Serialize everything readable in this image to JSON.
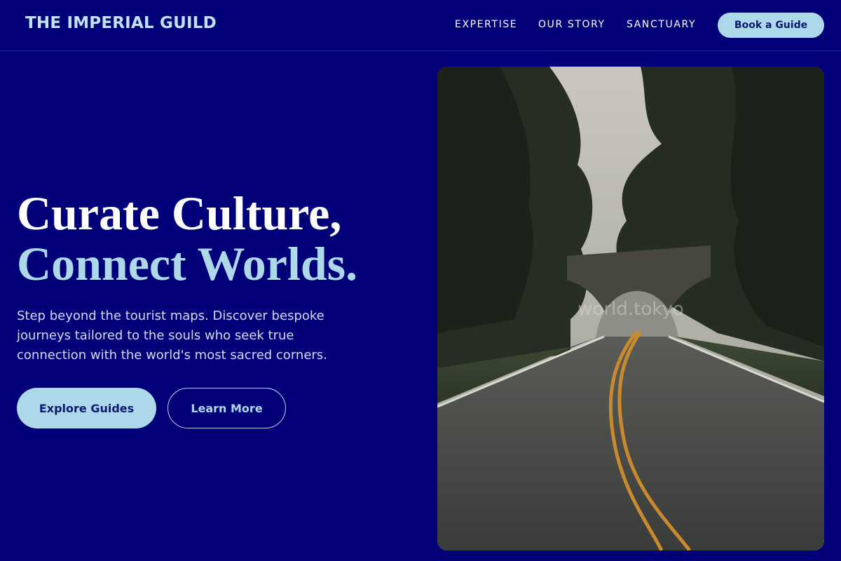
{
  "header": {
    "logo": "THE IMPERIAL GUILD",
    "nav": [
      "EXPERTISE",
      "OUR STORY",
      "SANCTUARY"
    ],
    "cta": "Book a Guide"
  },
  "hero": {
    "title_line1": "Curate Culture,",
    "title_line2": "Connect Worlds.",
    "description": "Step beyond the tourist maps. Discover bespoke journeys tailored to the souls who seek true connection with the world's most sacred corners.",
    "primary_button": "Explore Guides",
    "secondary_button": "Learn More",
    "image_watermark": "world.tokyo"
  },
  "colors": {
    "background": "#020079",
    "accent": "#add8ea",
    "text": "#ffffff"
  }
}
